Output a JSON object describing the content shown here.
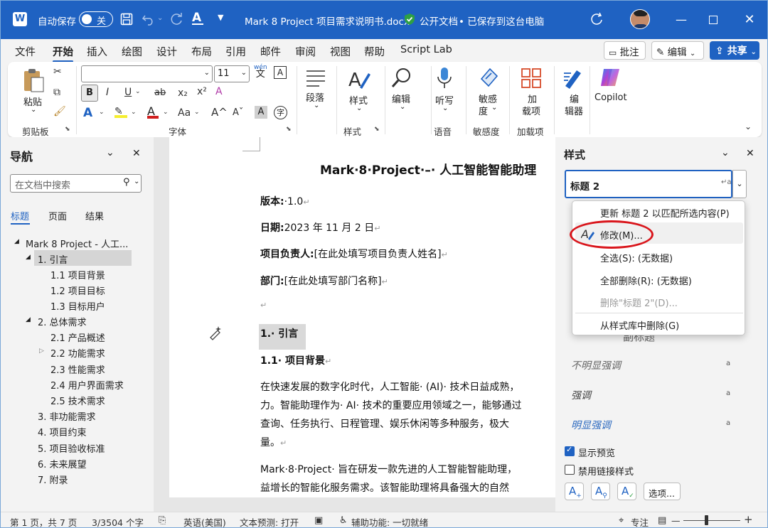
{
  "titlebar": {
    "autosave_label": "自动保存",
    "autosave_state": "关",
    "doc_title": "Mark 8 Project 项目需求说明书.docx",
    "public_doc": "公开文档",
    "save_status": "• 已保存到这台电脑"
  },
  "menu": {
    "tabs": [
      "文件",
      "开始",
      "插入",
      "绘图",
      "设计",
      "布局",
      "引用",
      "邮件",
      "审阅",
      "视图",
      "帮助",
      "Script Lab"
    ],
    "active": "开始",
    "comment": "批注",
    "edit": "编辑",
    "share": "共享"
  },
  "ribbon": {
    "paste": "粘贴",
    "clipboard": "剪贴板",
    "font_size": "11",
    "wen": "wén",
    "font_group": "字体",
    "paragraph": "段落",
    "style": "样式",
    "styles_group": "样式",
    "editing": "编辑",
    "dictate": "听写",
    "voice_group": "语音",
    "sensitivity1": "敏感",
    "sensitivity2": "度",
    "sensitivity_group": "敏感度",
    "addins1": "加",
    "addins2": "载项",
    "addins_group": "加载项",
    "editor1": "编",
    "editor2": "辑器",
    "copilot": "Copilot",
    "font_labels": [
      "B",
      "I",
      "U",
      "ab",
      "x₂",
      "x²",
      "A",
      "Aa",
      "A^",
      "Aˇ",
      "A",
      "字"
    ]
  },
  "nav": {
    "title": "导航",
    "search_placeholder": "在文档中搜索",
    "tabs": [
      "标题",
      "页面",
      "结果"
    ],
    "items": [
      {
        "label": "Mark 8 Project - 人工..."
      },
      {
        "label": "1. 引言"
      },
      {
        "label": "1.1 项目背景"
      },
      {
        "label": "1.2 项目目标"
      },
      {
        "label": "1.3 目标用户"
      },
      {
        "label": "2. 总体需求"
      },
      {
        "label": "2.1 产品概述"
      },
      {
        "label": "2.2 功能需求"
      },
      {
        "label": "2.3 性能需求"
      },
      {
        "label": "2.4 用户界面需求"
      },
      {
        "label": "2.5 技术需求"
      },
      {
        "label": "3. 非功能需求"
      },
      {
        "label": "4. 项目约束"
      },
      {
        "label": "5. 项目验收标准"
      },
      {
        "label": "6. 未来展望"
      },
      {
        "label": "7. 附录"
      }
    ]
  },
  "document": {
    "title": "Mark·8·Project·–· 人工智能智能助理",
    "version_label": "版本:",
    "version_value": "·1.0",
    "date_label": "日期:",
    "date_value": "2023 年 11 月 2 日",
    "owner_label": "项目负责人:",
    "owner_value": "[在此处填写项目负责人姓名]",
    "dept_label": "部门:",
    "dept_value": "[在此处填写部门名称]",
    "h1": "1.· 引言",
    "h2": "1.1· 项目背景",
    "p1": [
      "在快速发展的数字化时代，人工智能· (AI)· 技术日益成熟，",
      "力。智能助理作为· AI· 技术的重要应用领域之一，能够通过",
      "查询、任务执行、日程管理、娱乐休闲等多种服务，极大",
      "量。"
    ],
    "p2": [
      "Mark·8·Project· 旨在研发一款先进的人工智能智能助理，",
      "益增长的智能化服务需求。该智能助理将具备强大的自然"
    ]
  },
  "styles": {
    "title": "样式",
    "current": "标题 2",
    "context_menu": [
      {
        "label": "更新 标题 2 以匹配所选内容(P)",
        "disabled": false
      },
      {
        "label": "修改(M)...",
        "disabled": false
      },
      {
        "label": "全选(S): (无数据)",
        "disabled": false
      },
      {
        "label": "全部删除(R): (无数据)",
        "disabled": false
      },
      {
        "label": "删除\"标题 2\"(D)...",
        "disabled": true
      },
      {
        "label": "从样式库中删除(G)",
        "disabled": false
      }
    ],
    "subtitle_partial": "副标题",
    "list": [
      {
        "label": "不明显强调",
        "mark": "a"
      },
      {
        "label": "强调",
        "mark": "a"
      },
      {
        "label": "明显强调",
        "mark": "a"
      }
    ],
    "show_preview": "显示预览",
    "disable_linked": "禁用链接样式",
    "options": "选项..."
  },
  "status": {
    "page": "第 1 页，共 7 页",
    "words": "3/3504 个字",
    "language": "英语(美国)",
    "text_predict": "文本预测: 打开",
    "accessibility": "辅助功能: 一切就绪",
    "focus": "专注"
  },
  "colors": {
    "accent": "#1f62c2",
    "highlight_circle": "#d9161c",
    "selection": "#d9d9d9"
  }
}
